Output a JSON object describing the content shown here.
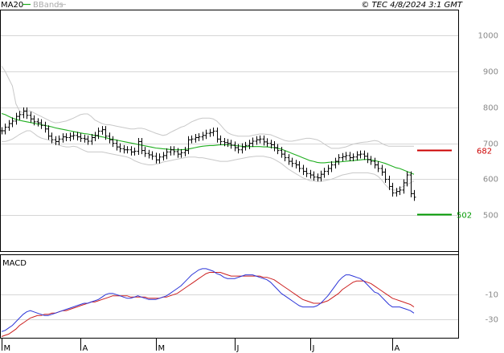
{
  "header": {
    "legend_ma": "MA20",
    "legend_bb": "BBands",
    "copyright": "© TEC 4/8/2024 3:1 GMT"
  },
  "colors": {
    "ma": "#1fae1f",
    "bands": "#c8c8c8",
    "price": "#000000",
    "macd": "#2b34d8",
    "signal": "#cc2020",
    "resistance": "#cc0000",
    "support": "#009900",
    "grid": "#d6d6d6"
  },
  "chart_data": [
    {
      "type": "ohlc",
      "title": "",
      "y_ticks": [
        {
          "value": 1000,
          "label": "1000"
        },
        {
          "value": 900,
          "label": "900"
        },
        {
          "value": 800,
          "label": "800"
        },
        {
          "value": 700,
          "label": "700"
        },
        {
          "value": 600,
          "label": "600"
        },
        {
          "value": 500,
          "label": "500"
        }
      ],
      "ylim": [
        400,
        1070
      ],
      "x_labels": [
        {
          "index": 0,
          "label": "M"
        },
        {
          "index": 22,
          "label": "A"
        },
        {
          "index": 43,
          "label": "M"
        },
        {
          "index": 65,
          "label": "J"
        },
        {
          "index": 86,
          "label": "J"
        },
        {
          "index": 109,
          "label": "A"
        }
      ],
      "close": [
        735,
        745,
        755,
        762,
        775,
        780,
        790,
        778,
        768,
        760,
        757,
        750,
        740,
        720,
        710,
        705,
        712,
        718,
        716,
        720,
        722,
        718,
        714,
        712,
        706,
        716,
        722,
        734,
        738,
        720,
        710,
        700,
        690,
        685,
        682,
        682,
        676,
        678,
        705,
        680,
        672,
        668,
        664,
        654,
        662,
        666,
        676,
        682,
        677,
        670,
        674,
        680,
        710,
        712,
        716,
        718,
        722,
        728,
        730,
        734,
        712,
        705,
        702,
        700,
        695,
        688,
        682,
        690,
        694,
        700,
        706,
        710,
        712,
        704,
        700,
        696,
        688,
        680,
        670,
        660,
        650,
        644,
        640,
        630,
        622,
        616,
        612,
        606,
        604,
        614,
        622,
        630,
        640,
        650,
        660,
        663,
        666,
        660,
        662,
        668,
        670,
        664,
        655,
        650,
        640,
        630,
        620,
        600,
        580,
        562,
        566,
        570,
        590,
        612,
        560,
        550
      ],
      "ma20": [
        783,
        780,
        775,
        770,
        767,
        764,
        762,
        760,
        758,
        756,
        754,
        752,
        750,
        748,
        746,
        743,
        741,
        739,
        737,
        735,
        733,
        731,
        729,
        727,
        726,
        724,
        722,
        720,
        718,
        716,
        713,
        711,
        709,
        707,
        705,
        703,
        701,
        699,
        697,
        695,
        693,
        691,
        689,
        687,
        686,
        685,
        684,
        683,
        682,
        682,
        682,
        683,
        684,
        686,
        688,
        690,
        692,
        693,
        694,
        694,
        695,
        696,
        696,
        696,
        695,
        694,
        693,
        692,
        691,
        691,
        691,
        691,
        691,
        690,
        690,
        689,
        688,
        686,
        684,
        680,
        676,
        672,
        668,
        664,
        660,
        656,
        652,
        650,
        647,
        646,
        646,
        647,
        648,
        648,
        648,
        649,
        650,
        651,
        652,
        653,
        654,
        655,
        655,
        654,
        652,
        650,
        647,
        644,
        640,
        636,
        632,
        630,
        626,
        622,
        618,
        614
      ],
      "bb_upper": [
        915,
        900,
        880,
        860,
        810,
        790,
        785,
        790,
        790,
        785,
        780,
        775,
        770,
        765,
        760,
        757,
        758,
        760,
        762,
        766,
        770,
        775,
        780,
        782,
        782,
        775,
        765,
        760,
        755,
        752,
        752,
        750,
        748,
        746,
        744,
        742,
        740,
        740,
        742,
        742,
        740,
        736,
        732,
        728,
        725,
        722,
        724,
        730,
        735,
        740,
        745,
        748,
        754,
        760,
        764,
        768,
        770,
        770,
        770,
        768,
        762,
        752,
        740,
        730,
        725,
        722,
        720,
        720,
        720,
        720,
        722,
        724,
        726,
        726,
        725,
        724,
        720,
        716,
        712,
        708,
        706,
        706,
        708,
        710,
        712,
        714,
        714,
        712,
        710,
        705,
        698,
        692,
        686,
        686,
        686,
        688,
        690,
        694,
        698,
        700,
        702,
        703,
        704,
        706,
        708,
        706,
        700,
        695,
        692,
        692,
        692,
        692,
        692,
        692,
        692,
        692
      ],
      "bb_lower": [
        705,
        705,
        708,
        712,
        718,
        725,
        730,
        735,
        735,
        728,
        720,
        715,
        712,
        710,
        705,
        700,
        695,
        692,
        690,
        690,
        692,
        690,
        685,
        680,
        676,
        676,
        676,
        676,
        676,
        674,
        672,
        670,
        668,
        666,
        664,
        662,
        658,
        652,
        648,
        644,
        642,
        640,
        640,
        642,
        644,
        648,
        650,
        652,
        654,
        656,
        658,
        660,
        662,
        662,
        662,
        660,
        660,
        658,
        656,
        654,
        652,
        650,
        650,
        650,
        652,
        654,
        656,
        658,
        660,
        662,
        663,
        664,
        664,
        664,
        662,
        660,
        656,
        650,
        644,
        636,
        628,
        622,
        616,
        610,
        604,
        600,
        596,
        596,
        594,
        594,
        596,
        598,
        600,
        604,
        608,
        612,
        614,
        616,
        618,
        618,
        618,
        618,
        618,
        616,
        614,
        608,
        598,
        585,
        575,
        570,
        570,
        575,
        580,
        585,
        590,
        595
      ]
    },
    {
      "type": "line",
      "title": "MACD",
      "y_ticks": [
        {
          "value": -10,
          "label": "-10"
        },
        {
          "value": -30,
          "label": "-30"
        }
      ],
      "ylim": [
        -45,
        22
      ],
      "macd": [
        -40,
        -39,
        -37,
        -35,
        -32,
        -29,
        -26,
        -24,
        -23,
        -24,
        -25,
        -26,
        -27,
        -27,
        -26,
        -25,
        -24,
        -23,
        -22,
        -21,
        -20,
        -19,
        -18,
        -17,
        -17,
        -16,
        -15,
        -14,
        -12,
        -10,
        -9,
        -9,
        -10,
        -11,
        -12,
        -13,
        -13,
        -12,
        -11,
        -12,
        -13,
        -14,
        -14,
        -14,
        -13,
        -12,
        -11,
        -9,
        -7,
        -5,
        -3,
        0,
        3,
        6,
        8,
        10,
        11,
        11,
        10,
        9,
        7,
        6,
        4,
        3,
        3,
        3,
        4,
        5,
        6,
        6,
        6,
        5,
        4,
        3,
        2,
        0,
        -3,
        -6,
        -9,
        -11,
        -13,
        -15,
        -17,
        -19,
        -20,
        -20,
        -20,
        -20,
        -19,
        -17,
        -14,
        -11,
        -7,
        -3,
        1,
        4,
        6,
        6,
        5,
        4,
        3,
        1,
        -2,
        -5,
        -8,
        -9,
        -12,
        -15,
        -18,
        -20,
        -20,
        -20,
        -21,
        -22,
        -23,
        -25
      ],
      "signal": [
        -44,
        -43,
        -42,
        -40,
        -38,
        -35,
        -33,
        -31,
        -29,
        -28,
        -27,
        -27,
        -26,
        -26,
        -25,
        -25,
        -24,
        -23,
        -23,
        -22,
        -21,
        -20,
        -19,
        -18,
        -17,
        -16,
        -16,
        -15,
        -14,
        -13,
        -12,
        -11,
        -11,
        -11,
        -11,
        -11,
        -12,
        -12,
        -12,
        -12,
        -12,
        -13,
        -13,
        -13,
        -13,
        -12,
        -12,
        -11,
        -10,
        -9,
        -7,
        -5,
        -3,
        -1,
        1,
        3,
        5,
        7,
        8,
        8,
        8,
        8,
        7,
        6,
        5,
        5,
        5,
        5,
        5,
        5,
        5,
        5,
        5,
        4,
        4,
        3,
        2,
        0,
        -2,
        -4,
        -6,
        -8,
        -10,
        -12,
        -14,
        -15,
        -16,
        -17,
        -17,
        -17,
        -16,
        -15,
        -13,
        -11,
        -9,
        -6,
        -4,
        -2,
        0,
        1,
        1,
        1,
        0,
        -1,
        -3,
        -5,
        -7,
        -9,
        -11,
        -13,
        -14,
        -15,
        -16,
        -17,
        -18,
        -20
      ]
    }
  ],
  "levels": {
    "resistance": {
      "value": 682,
      "label": "682"
    },
    "support": {
      "value": 502,
      "label": "502"
    }
  }
}
